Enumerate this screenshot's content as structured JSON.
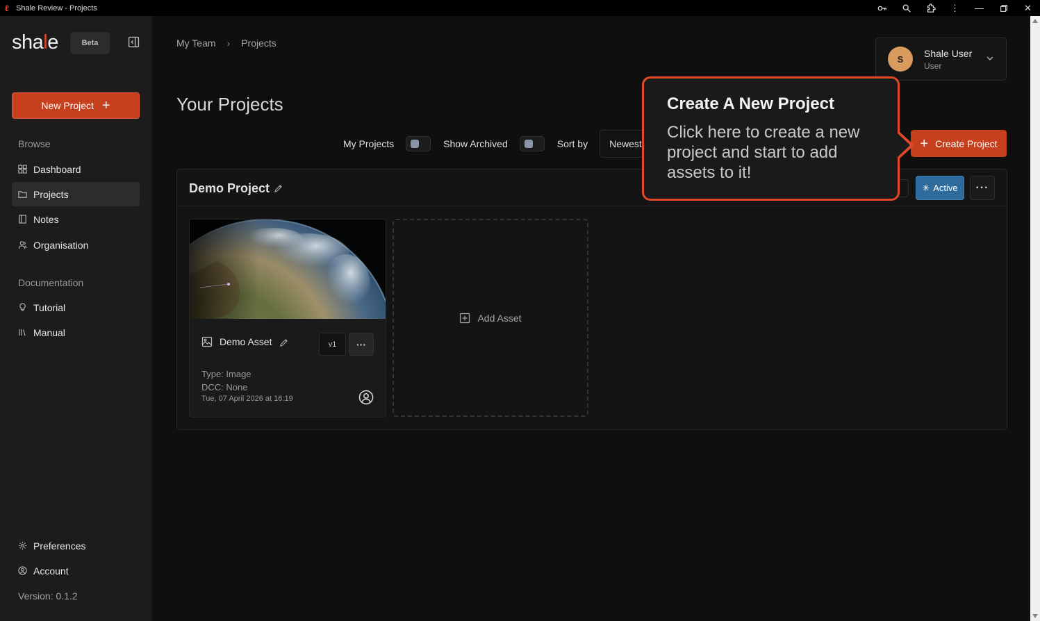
{
  "window": {
    "title": "Shale Review - Projects"
  },
  "sidebar": {
    "logo_prefix": "sha",
    "logo_mark": "l",
    "logo_suffix": "e",
    "beta_label": "Beta",
    "new_project_label": "New Project",
    "browse_label": "Browse",
    "browse_items": [
      {
        "label": "Dashboard",
        "icon": "dashboard-icon"
      },
      {
        "label": "Projects",
        "icon": "folder-icon",
        "active": true
      },
      {
        "label": "Notes",
        "icon": "notebook-icon"
      },
      {
        "label": "Organisation",
        "icon": "people-icon"
      }
    ],
    "documentation_label": "Documentation",
    "doc_items": [
      {
        "label": "Tutorial",
        "icon": "lightbulb-icon"
      },
      {
        "label": "Manual",
        "icon": "library-icon"
      }
    ],
    "footer_items": [
      {
        "label": "Preferences",
        "icon": "gear-icon"
      },
      {
        "label": "Account",
        "icon": "user-circle-icon"
      }
    ],
    "version": "Version: 0.1.2"
  },
  "header": {
    "breadcrumb": [
      "My Team",
      "Projects"
    ],
    "page_title": "Your Projects",
    "user": {
      "initial": "S",
      "name": "Shale User",
      "role": "User"
    }
  },
  "filters": {
    "my_projects_label": "My Projects",
    "show_archived_label": "Show Archived",
    "sort_by_label": "Sort by",
    "sort_value": "Newest First"
  },
  "create_project_label": "Create Project",
  "project": {
    "name": "Demo Project",
    "status_label": "Active",
    "assets": [
      {
        "name": "Demo Asset",
        "version": "v1",
        "type": "Type: Image",
        "dcc": "DCC: None",
        "date": "Tue, 07 April 2026 at 16:19"
      }
    ],
    "add_asset_label": "Add Asset"
  },
  "tooltip": {
    "title": "Create A New Project",
    "body": "Click here to create a new project and start to add assets to it!"
  },
  "colors": {
    "accent": "#c7401e",
    "accent_border": "#e0482a",
    "active_blue": "#2f6a9c"
  }
}
